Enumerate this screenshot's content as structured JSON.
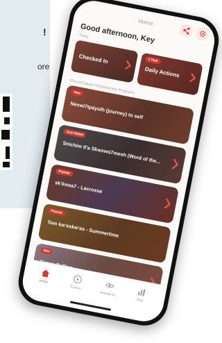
{
  "background": {
    "fragment_a": "!",
    "fragment_b": "ore"
  },
  "app": {
    "screen_title": "Home",
    "greeting": "Good afternoon, Key",
    "header_buttons": [
      {
        "icon": "share-icon",
        "label": "Share"
      },
      {
        "icon": "gear-icon",
        "label": "Settings"
      }
    ]
  },
  "today": {
    "section_label": "Today",
    "cards": [
      {
        "label": "Checked In",
        "tag": ""
      },
      {
        "label": "Daily Actions",
        "tag": "1 Task"
      }
    ]
  },
  "programs": {
    "section_label": "Recent/Saved Onkwehonwe Programs",
    "items": [
      {
        "title": "Nexwi7tpáyulh (journey) to self",
        "tag": "New"
      },
      {
        "title": "Snichim tl'a Skwxwú7mesh (Word of the...",
        "tag": "Just Added"
      },
      {
        "title": "sk'éxwa7 - Lacrosse",
        "tag": "Popular"
      },
      {
        "title": "Tem kw'eskw'as - Summertime",
        "tag": "Popular"
      },
      {
        "title": "Canoe Pulling",
        "tag": "New"
      }
    ]
  },
  "tabs": [
    {
      "label": "Home",
      "icon": "home-icon",
      "active": true
    },
    {
      "label": "Explore",
      "icon": "compass-icon",
      "active": false
    },
    {
      "label": "Meditations",
      "icon": "eye-icon",
      "active": false
    },
    {
      "label": "Stats",
      "icon": "chart-icon",
      "active": false
    }
  ],
  "colors": {
    "accent": "#d23a32",
    "background_panel": "#e2ebf0"
  }
}
